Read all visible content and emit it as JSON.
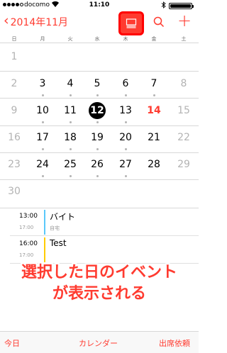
{
  "status_bar": {
    "carrier": "docomo",
    "wifi_icon": "wifi-icon",
    "time": "11:10",
    "bluetooth_icon": "bluetooth-icon",
    "battery_level": 1.0
  },
  "nav": {
    "back_label": "2014年11月",
    "back_icon": "chevron-left-icon",
    "list_toggle_icon": "list-toggle-icon",
    "search_icon": "search-icon",
    "add_label": "+"
  },
  "weekdays": [
    "日",
    "月",
    "火",
    "水",
    "木",
    "金",
    "土"
  ],
  "calendar": {
    "rows": [
      [
        "1",
        "",
        "",
        "",
        "",
        "",
        ""
      ],
      [
        "2",
        "3",
        "4",
        "5",
        "6",
        "7",
        "8"
      ],
      [
        "9",
        "10",
        "11",
        "12",
        "13",
        "14",
        "15"
      ],
      [
        "16",
        "17",
        "18",
        "19",
        "20",
        "21",
        "22"
      ],
      [
        "23",
        "24",
        "25",
        "26",
        "27",
        "28",
        "29"
      ],
      [
        "30",
        "",
        "",
        "",
        "",
        "",
        ""
      ]
    ],
    "selected_day": "12",
    "today": "14"
  },
  "events": [
    {
      "start": "13:00",
      "end": "17:00",
      "title": "バイト",
      "location": "自宅",
      "color": "#5ac8fa"
    },
    {
      "start": "16:00",
      "end": "17:00",
      "title": "Test",
      "location": "",
      "color": "#ffcc00"
    }
  ],
  "annotation": {
    "line1": "選択した日のイベント",
    "line2": "が表示される"
  },
  "toolbar": {
    "today": "今日",
    "calendars": "カレンダー",
    "inbox": "出席依頼"
  },
  "colors": {
    "accent": "#ff3b30",
    "highlight_border": "#ff0000"
  }
}
